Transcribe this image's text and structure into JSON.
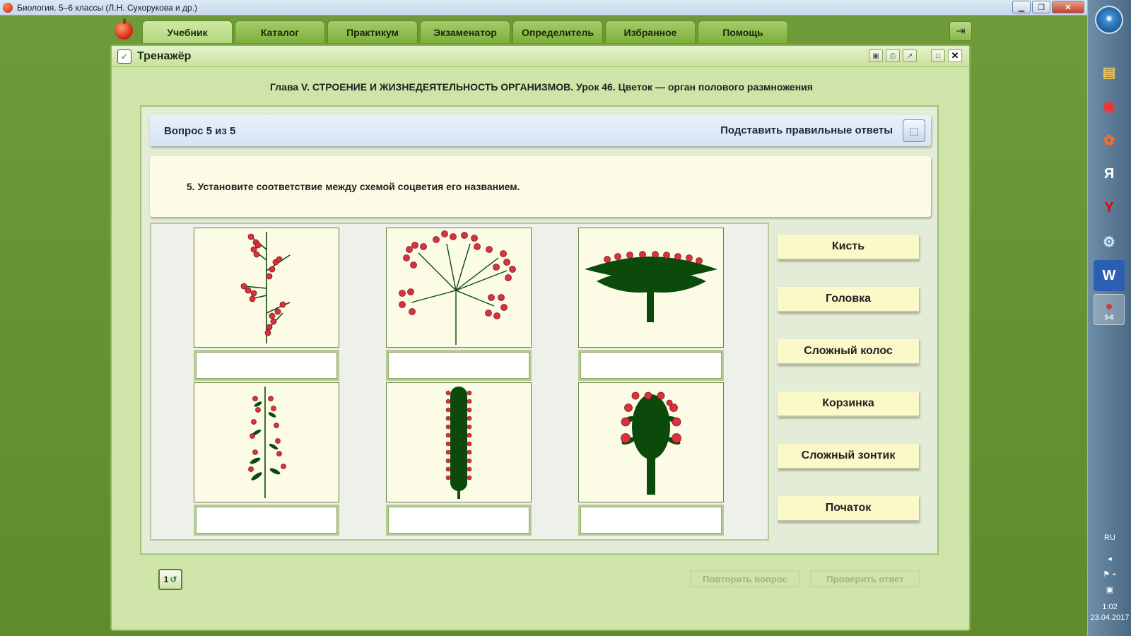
{
  "os": {
    "window_title": "Биология. 5–6 классы (Л.Н. Сухорукова и др.)"
  },
  "tabs": [
    "Учебник",
    "Каталог",
    "Практикум",
    "Экзаменатор",
    "Определитель",
    "Избранное",
    "Помощь"
  ],
  "panel": {
    "title": "Тренажёр",
    "chapter": "Глава V. СТРОЕНИЕ И ЖИЗНЕДЕЯТЕЛЬНОСТЬ ОРГАНИЗМОВ. Урок 46. Цветок — орган полового размножения",
    "question_counter": "Вопрос 5 из 5",
    "substitute_label": "Подставить правильные ответы",
    "question_text": "5. Установите соответствие между схемой соцветия его названием.",
    "images": [
      {
        "icon": "raceme-diagram"
      },
      {
        "icon": "compound-umbel-diagram"
      },
      {
        "icon": "capitulum-basket-diagram"
      },
      {
        "icon": "compound-spike-diagram"
      },
      {
        "icon": "spadix-diagram"
      },
      {
        "icon": "head-diagram"
      }
    ],
    "answers": [
      "Кисть",
      "Головка",
      "Сложный колос",
      "Корзинка",
      "Сложный зонтик",
      "Початок"
    ],
    "footer": {
      "reset_label": "1",
      "repeat_label": "Повторить вопрос",
      "check_label": "Проверить ответ"
    }
  },
  "taskbar": {
    "lang": "RU",
    "time": "1:02",
    "date": "23.04.2017",
    "items": [
      "folder-icon",
      "chrome-icon",
      "app-icon",
      "yandex-icon",
      "yandex-browser-icon",
      "network-icon",
      "word-icon",
      "biology-app-icon"
    ],
    "active_badge": "5-6"
  },
  "colors": {
    "berry": "#d9323e",
    "stem": "#0b4a0b",
    "accent": "#8db654"
  }
}
